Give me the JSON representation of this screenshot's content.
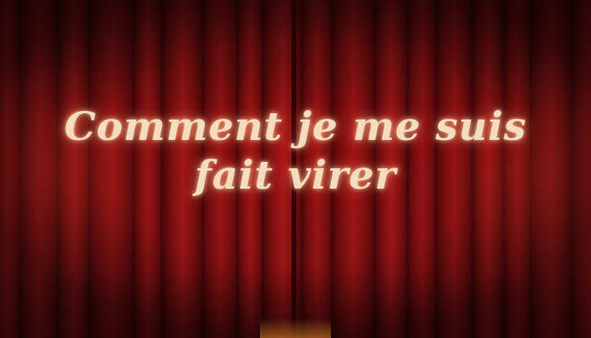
{
  "title": {
    "line1": "Comment je me suis",
    "line2": "fait virer"
  },
  "colors": {
    "curtain_base": "#8a0f12",
    "curtain_dark": "#3f0507",
    "curtain_light": "#c2201e",
    "title_text": "#f3dcc0",
    "title_glow": "#ffb478",
    "floor_glow": "#e08a2a"
  }
}
